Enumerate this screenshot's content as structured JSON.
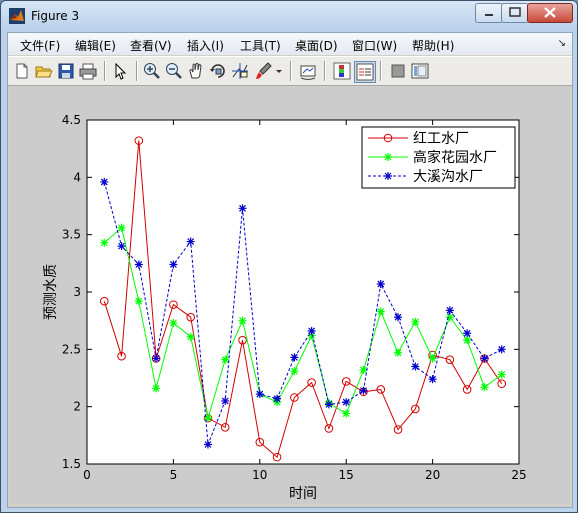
{
  "window": {
    "title": "Figure 3"
  },
  "menu": [
    {
      "label": "文件(F)"
    },
    {
      "label": "编辑(E)"
    },
    {
      "label": "查看(V)"
    },
    {
      "label": "插入(I)"
    },
    {
      "label": "工具(T)"
    },
    {
      "label": "桌面(D)"
    },
    {
      "label": "窗口(W)"
    },
    {
      "label": "帮助(H)"
    }
  ],
  "menu_overflow": "↘",
  "toolbar": [
    "new-figure",
    "open-file",
    "save",
    "print",
    "select-arrow",
    "zoom-in",
    "zoom-out",
    "pan",
    "rotate-3d",
    "data-cursor",
    "brush",
    "brush-dropdown",
    "link-plot",
    "colorbar",
    "legend",
    "hide-plot-tools",
    "show-plot-tools"
  ],
  "colors": {
    "series1": "#d40000",
    "series2": "#00ff00",
    "series3": "#0000cc"
  },
  "chart_data": {
    "type": "line",
    "title": "",
    "xlabel": "时间",
    "ylabel": "预测水质",
    "xlim": [
      0,
      25
    ],
    "ylim": [
      1.5,
      4.5
    ],
    "xticks": [
      "0",
      "5",
      "10",
      "15",
      "20",
      "25"
    ],
    "yticks": [
      "1.5",
      "2",
      "2.5",
      "3",
      "3.5",
      "4",
      "4.5"
    ],
    "grid": false,
    "legend_position": "top-right",
    "x": [
      1,
      2,
      3,
      4,
      5,
      6,
      7,
      8,
      9,
      10,
      11,
      12,
      13,
      14,
      15,
      16,
      17,
      18,
      19,
      20,
      21,
      22,
      23,
      24
    ],
    "series": [
      {
        "name": "红工水厂",
        "color": "#d40000",
        "marker": "circle",
        "line": "solid",
        "values": [
          2.92,
          2.44,
          4.32,
          2.42,
          2.89,
          2.78,
          1.9,
          1.82,
          2.58,
          1.69,
          1.56,
          2.08,
          2.21,
          1.81,
          2.22,
          2.13,
          2.15,
          1.8,
          1.98,
          2.45,
          2.41,
          2.15,
          2.42,
          2.2
        ]
      },
      {
        "name": "高家花园水厂",
        "color": "#00ff00",
        "marker": "star",
        "line": "solid",
        "values": [
          3.43,
          3.56,
          2.92,
          2.16,
          2.73,
          2.61,
          1.9,
          2.41,
          2.75,
          2.11,
          2.04,
          2.31,
          2.62,
          2.03,
          1.94,
          2.32,
          2.83,
          2.47,
          2.74,
          2.42,
          2.78,
          2.58,
          2.17,
          2.28
        ]
      },
      {
        "name": "大溪沟水厂",
        "color": "#0000cc",
        "marker": "star",
        "line": "dashed",
        "values": [
          3.96,
          3.4,
          3.24,
          2.42,
          3.24,
          3.44,
          1.67,
          2.05,
          3.73,
          2.11,
          2.07,
          2.43,
          2.66,
          2.02,
          2.04,
          2.14,
          3.07,
          2.78,
          2.35,
          2.24,
          2.84,
          2.64,
          2.42,
          2.5
        ]
      }
    ]
  }
}
